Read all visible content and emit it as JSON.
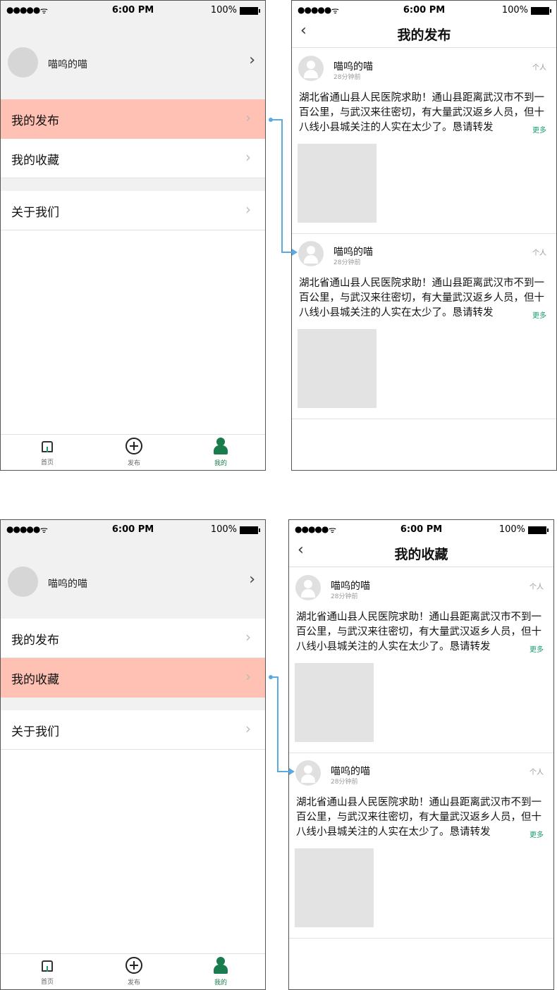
{
  "status_bar": {
    "signal": "●●●●●",
    "time": "6:00 PM",
    "battery": "100%"
  },
  "me_screen": {
    "profile_name": "喵呜的喵",
    "menu": [
      "我的发布",
      "我的收藏",
      "关于我们"
    ]
  },
  "tabbar": {
    "home": "首页",
    "publish": "发布",
    "mine": "我的"
  },
  "post": {
    "author": "喵呜的喵",
    "time": "28分钟前",
    "tag": "个人",
    "text": "湖北省通山县人民医院求助！通山县距离武汉市不到一百公里，与武汉来往密切，有大量武汉返乡人员，但十八线小县城关注的人实在太少了。恳请转发",
    "more": "更多"
  },
  "screens": [
    {
      "title": "我的发布",
      "highlighted_menu": "我的发布"
    },
    {
      "title": "我的收藏",
      "highlighted_menu": "我的收藏"
    }
  ],
  "colors": {
    "highlight": "#ffc1b3",
    "accent": "#1a7c4c",
    "connector": "#5aa9e0"
  }
}
